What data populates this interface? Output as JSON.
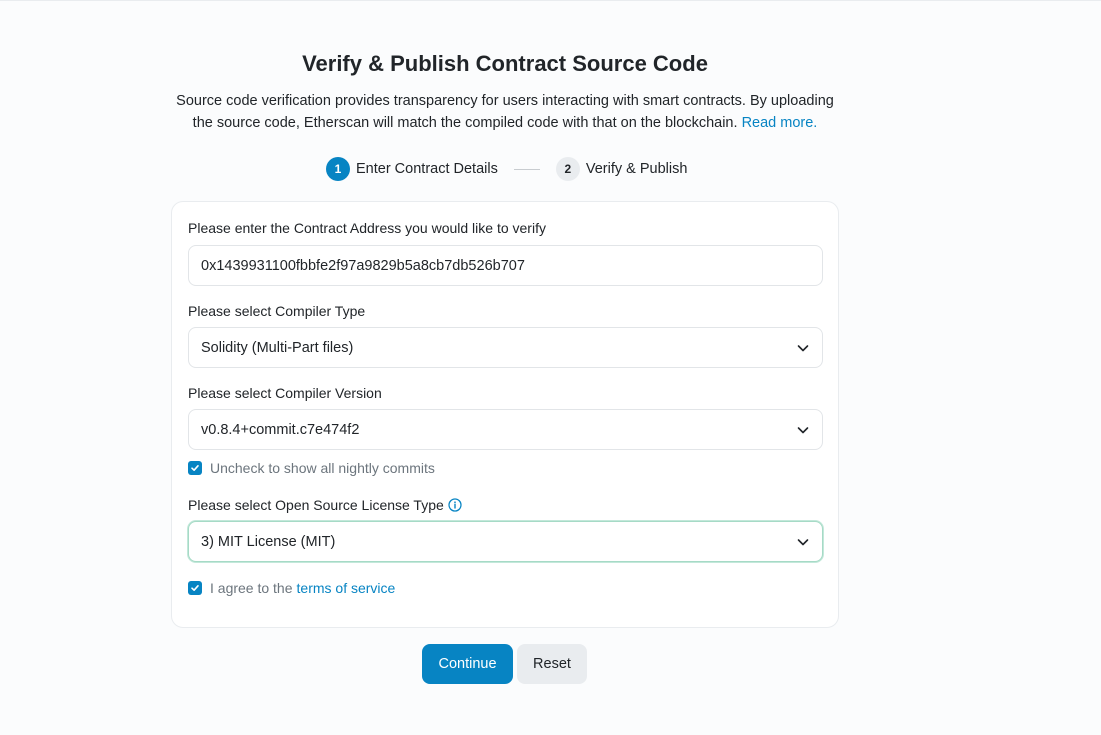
{
  "header": {
    "title": "Verify & Publish Contract Source Code",
    "description": "Source code verification provides transparency for users interacting with smart contracts. By uploading the source code, Etherscan will match the compiled code with that on the blockchain.",
    "read_more": "Read more."
  },
  "steps": [
    {
      "number": "1",
      "label": "Enter Contract Details",
      "active": true
    },
    {
      "number": "2",
      "label": "Verify & Publish",
      "active": false
    }
  ],
  "form": {
    "address_label": "Please enter the Contract Address you would like to verify",
    "address_value": "0x1439931100fbbfe2f97a9829b5a8cb7db526b707",
    "compiler_type_label": "Please select Compiler Type",
    "compiler_type_value": "Solidity (Multi-Part files)",
    "compiler_version_label": "Please select Compiler Version",
    "compiler_version_value": "v0.8.4+commit.c7e474f2",
    "nightly_label": "Uncheck to show all nightly commits",
    "nightly_checked": true,
    "license_label": "Please select Open Source License Type",
    "license_value": "3) MIT License (MIT)",
    "agree_prefix": "I agree to the",
    "agree_link": "terms of service",
    "agree_checked": true
  },
  "buttons": {
    "continue": "Continue",
    "reset": "Reset"
  },
  "colors": {
    "accent": "#0784c3",
    "focus_border": "#a6dac6"
  }
}
